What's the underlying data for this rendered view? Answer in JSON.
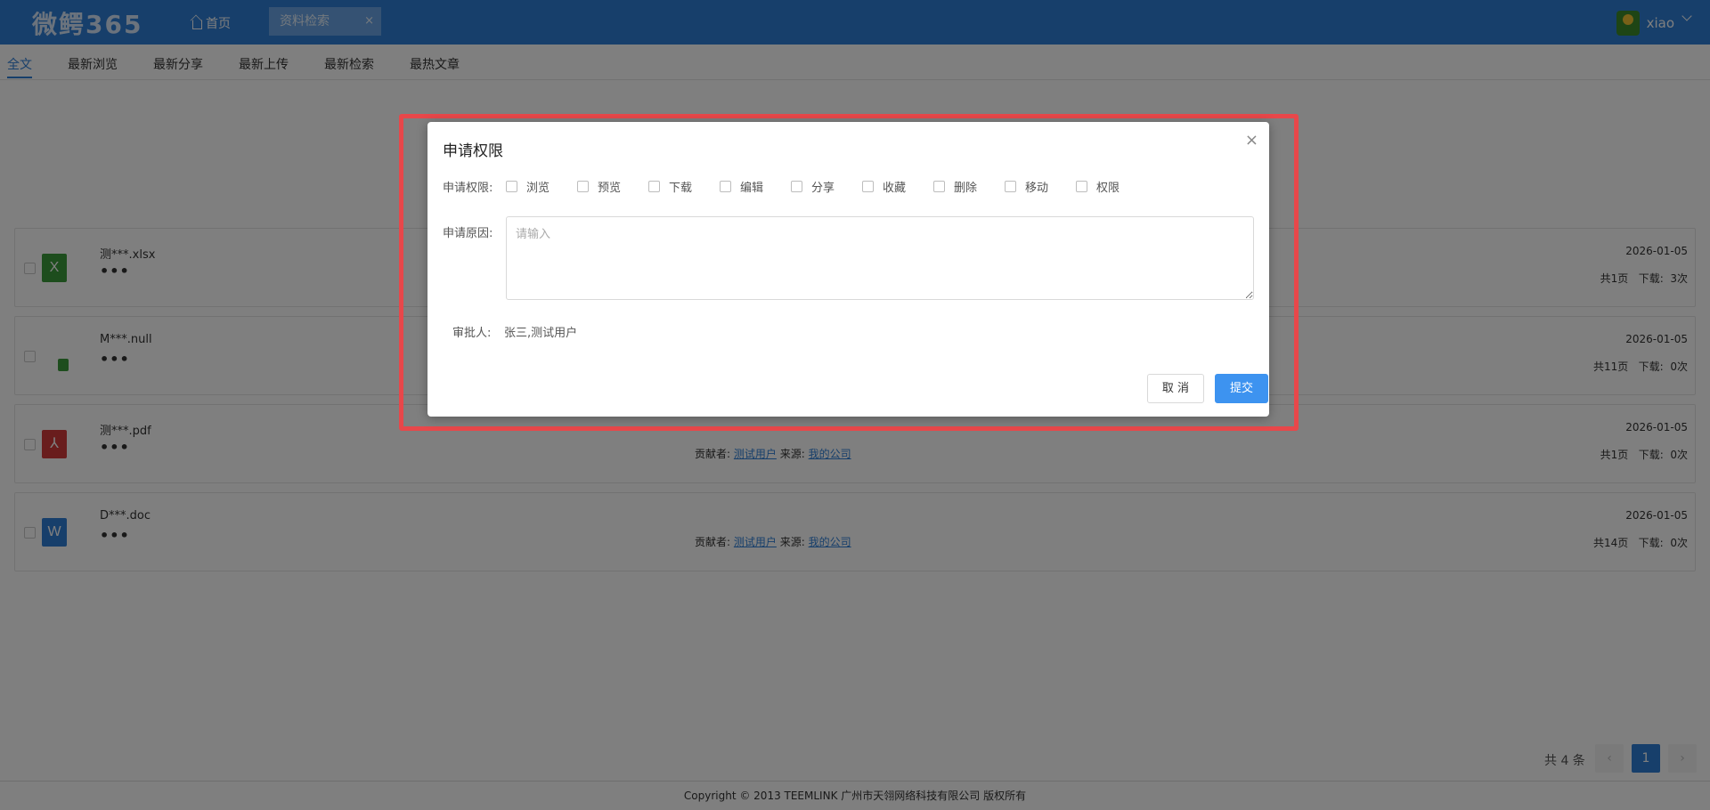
{
  "header": {
    "logo": "微鳄365",
    "home_label": "首页",
    "tab_label": "资料检索",
    "tab_close": "×",
    "username": "xiao"
  },
  "subtabs": [
    "全文",
    "最新浏览",
    "最新分享",
    "最新上传",
    "最新检索",
    "最热文章"
  ],
  "files": [
    {
      "name": "测***.xlsx",
      "icon": "excel-icon",
      "icon_text": "X",
      "color": "#3a9a3a",
      "date": "2026-01-05",
      "stats": "共1页   下载:  3次",
      "contributor_label": "",
      "contributor": "",
      "source_label": "",
      "source": ""
    },
    {
      "name": "M***.null",
      "icon": "file-icon",
      "icon_text": "",
      "color": "#3a9a3a",
      "date": "2026-01-05",
      "stats": "共11页   下载:  0次",
      "contributor_label": "",
      "contributor": "",
      "source_label": "",
      "source": ""
    },
    {
      "name": "测***.pdf",
      "icon": "pdf-icon",
      "icon_text": "⅄",
      "color": "#d23b3b",
      "date": "2026-01-05",
      "stats": "共1页   下载:  0次",
      "contributor_label": "贡献者:",
      "contributor": "测试用户",
      "source_label": "来源:",
      "source": "我的公司"
    },
    {
      "name": "D***.doc",
      "icon": "word-icon",
      "icon_text": "W",
      "color": "#2f7fd6",
      "date": "2026-01-05",
      "stats": "共14页   下载:  0次",
      "contributor_label": "贡献者:",
      "contributor": "测试用户",
      "source_label": "来源:",
      "source": "我的公司"
    }
  ],
  "more": "•••",
  "pagination": {
    "total": "共 4 条",
    "prev": "‹",
    "current": "1",
    "next": "›"
  },
  "footer": "Copyright © 2013 TEEMLINK 广州市天翎网络科技有限公司 版权所有",
  "dialog": {
    "title": "申请权限",
    "close": "×",
    "perm_label": "申请权限:",
    "permissions": [
      "浏览",
      "预览",
      "下载",
      "编辑",
      "分享",
      "收藏",
      "删除",
      "移动",
      "权限"
    ],
    "reason_label": "申请原因:",
    "reason_placeholder": "请输入",
    "approver_label": "审批人:",
    "approver_value": "张三,测试用户",
    "cancel": "取 消",
    "submit": "提交"
  },
  "colors": {
    "header": "#2f7fd6",
    "highlight": "#e8474a",
    "submit": "#3d93f0"
  }
}
